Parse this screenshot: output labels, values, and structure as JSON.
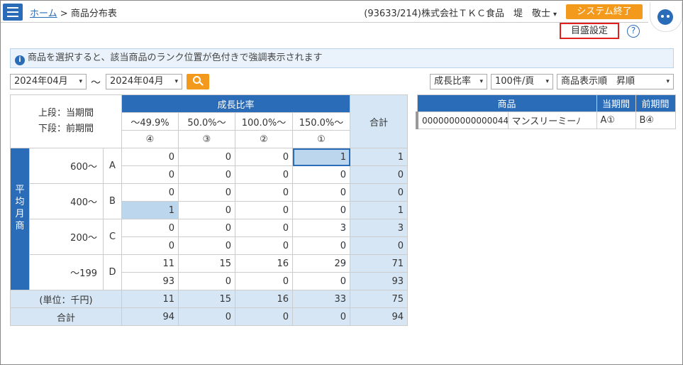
{
  "header": {
    "home": "ホーム",
    "separator": ">",
    "page_title": "商品分布表",
    "user_info": "(93633/214)株式会社ＴＫＣ食品　堤　敬士",
    "user_caret": "▾",
    "exit_label": "システム終了",
    "scale_label": "目盛設定",
    "help_label": "?"
  },
  "info": {
    "icon": "i",
    "message": "商品を選択すると、該当商品のランク位置が色付きで強調表示されます"
  },
  "filters": {
    "from": "2024年04月",
    "tilde": "～",
    "to": "2024年04月",
    "arrow": "▾",
    "growth": "成長比率",
    "per_page": "100件/頁",
    "sort": "商品表示順　昇順"
  },
  "matrix": {
    "corner": [
      "上段：当期間",
      "下段：前期間"
    ],
    "growth_title": "成長比率",
    "total_title": "合計",
    "columns": [
      {
        "range": "～49.9%",
        "rank": "④"
      },
      {
        "range": "50.0%～",
        "rank": "③"
      },
      {
        "range": "100.0%～",
        "rank": "②"
      },
      {
        "range": "150.0%～",
        "rank": "①"
      }
    ],
    "side_label": [
      "平",
      "均",
      "月",
      "商"
    ],
    "rows": [
      {
        "band": "600～",
        "rank": "A",
        "current": [
          "0",
          "0",
          "0",
          "1"
        ],
        "current_total": "1",
        "previous": [
          "0",
          "0",
          "0",
          "0"
        ],
        "previous_total": "0"
      },
      {
        "band": "400～",
        "rank": "B",
        "current": [
          "0",
          "0",
          "0",
          "0"
        ],
        "current_total": "0",
        "previous": [
          "1",
          "0",
          "0",
          "0"
        ],
        "previous_total": "1"
      },
      {
        "band": "200～",
        "rank": "C",
        "current": [
          "0",
          "0",
          "0",
          "3"
        ],
        "current_total": "3",
        "previous": [
          "0",
          "0",
          "0",
          "0"
        ],
        "previous_total": "0"
      },
      {
        "band": "～199",
        "rank": "D",
        "current": [
          "11",
          "15",
          "16",
          "29"
        ],
        "current_total": "71",
        "previous": [
          "93",
          "0",
          "0",
          "0"
        ],
        "previous_total": "93"
      }
    ],
    "unit_label": "(単位：千円)",
    "total_label": "合計",
    "totals_current": [
      "11",
      "15",
      "16",
      "33",
      "75"
    ],
    "totals_previous": [
      "94",
      "0",
      "0",
      "0",
      "94"
    ]
  },
  "products": {
    "headers": [
      "商品",
      "当期間",
      "前期間"
    ],
    "rows": [
      {
        "code": "0000000000000044",
        "name": "マンスリーミーﾉ",
        "current": "A①",
        "previous": "B④"
      }
    ]
  },
  "colors": {
    "primary": "#2b6cb8",
    "accent": "#f39a1d",
    "highlight": "#bcd6ee",
    "total_bg": "#d6e6f5"
  }
}
